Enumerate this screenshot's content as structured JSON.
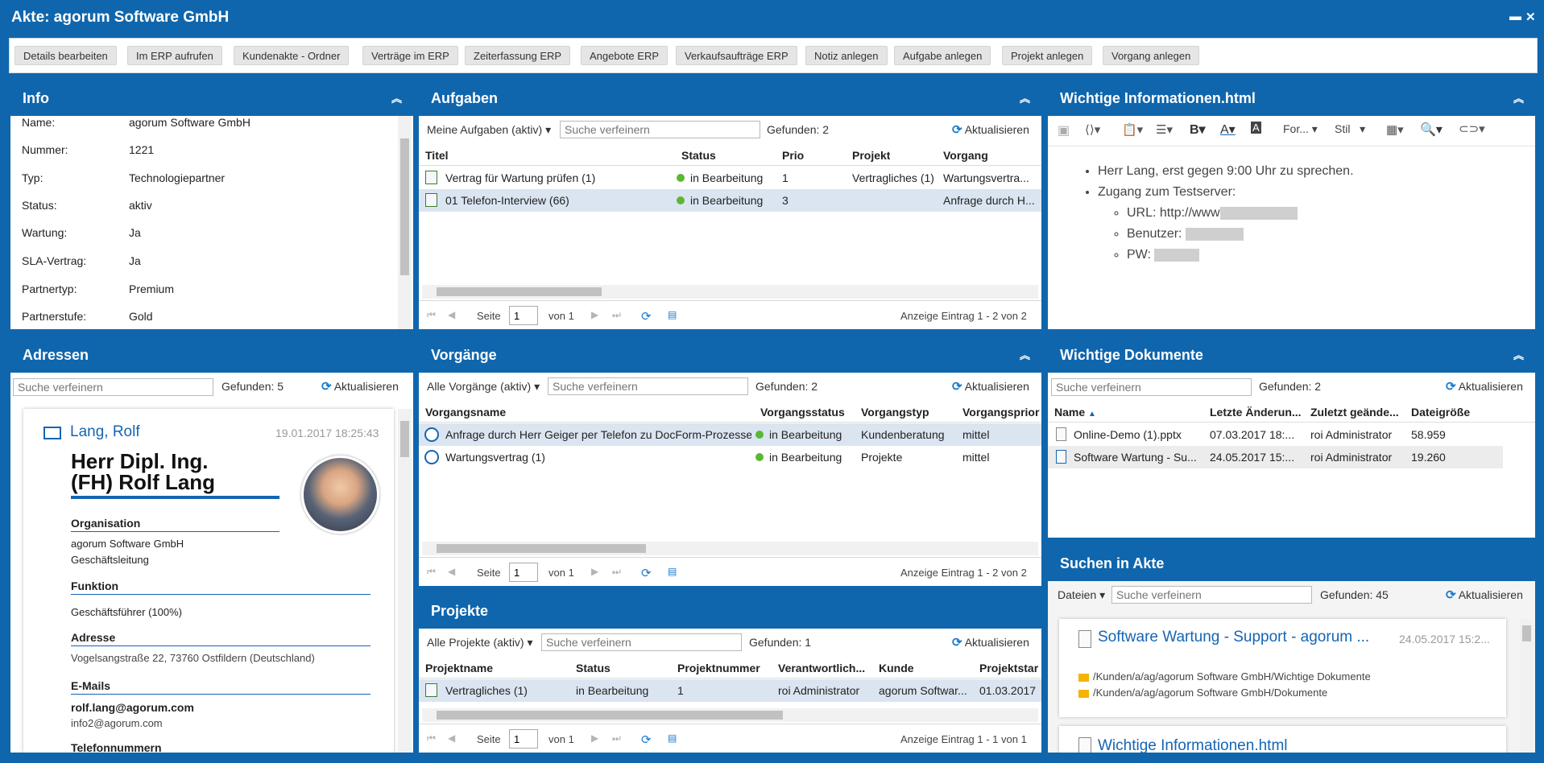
{
  "window": {
    "title": "Akte: agorum Software GmbH"
  },
  "toolbar": [
    "Details bearbeiten",
    "Im ERP aufrufen",
    "Kundenakte - Ordner",
    "Verträge im ERP",
    "Zeiterfassung ERP",
    "Angebote ERP",
    "Verkaufsaufträge ERP",
    "Notiz anlegen",
    "Aufgabe anlegen",
    "Projekt anlegen",
    "Vorgang anlegen"
  ],
  "info": {
    "title": "Info",
    "rows": [
      {
        "k": "Name:",
        "v": "agorum Software GmbH"
      },
      {
        "k": "Nummer:",
        "v": "1221"
      },
      {
        "k": "Typ:",
        "v": "Technologiepartner"
      },
      {
        "k": "Status:",
        "v": "aktiv"
      },
      {
        "k": "Wartung:",
        "v": "Ja"
      },
      {
        "k": "SLA-Vertrag:",
        "v": "Ja"
      },
      {
        "k": "Partnertyp:",
        "v": "Premium"
      },
      {
        "k": "Partnerstufe:",
        "v": "Gold"
      }
    ]
  },
  "aufgaben": {
    "title": "Aufgaben",
    "filter": "Meine Aufgaben (aktiv)",
    "search_placeholder": "Suche verfeinern",
    "found": "Gefunden: 2",
    "refresh": "Aktualisieren",
    "columns": [
      "Titel",
      "Status",
      "Prio",
      "Projekt",
      "Vorgang"
    ],
    "rows": [
      {
        "titel": "Vertrag für Wartung prüfen (1)",
        "status": "in Bearbeitung",
        "prio": "1",
        "projekt": "Vertragliches (1)",
        "vorgang": "Wartungsvertra..."
      },
      {
        "titel": "01 Telefon-Interview (66)",
        "status": "in Bearbeitung",
        "prio": "3",
        "projekt": "",
        "vorgang": "Anfrage durch H..."
      }
    ],
    "pager": {
      "seite": "Seite",
      "page": "1",
      "von": "von 1",
      "anzeige": "Anzeige Eintrag 1 - 2 von 2"
    }
  },
  "wichtig": {
    "title": "Wichtige Informationen.html",
    "toolbar": {
      "format": "For...",
      "stil": "Stil"
    },
    "items": [
      "Herr Lang, erst gegen 9:00 Uhr zu sprechen.",
      "Zugang zum Testserver:"
    ],
    "sub": [
      "URL: http://www",
      "Benutzer:",
      "PW:"
    ]
  },
  "adressen": {
    "title": "Adressen",
    "search_placeholder": "Suche verfeinern",
    "found": "Gefunden: 5",
    "refresh": "Aktualisieren",
    "card": {
      "name": "Lang, Rolf",
      "date": "19.01.2017 18:25:43",
      "fullname1": "Herr Dipl. Ing.",
      "fullname2": "(FH) Rolf Lang",
      "org_label": "Organisation",
      "org1": "agorum Software GmbH",
      "org2": "Geschäftsleitung",
      "funktion_label": "Funktion",
      "funktion": "Geschäftsführer (100%)",
      "adresse_label": "Adresse",
      "adresse": "Vogelsangstraße 22, 73760 Ostfildern (Deutschland)",
      "emails_label": "E-Mails",
      "email1": "rolf.lang@agorum.com",
      "email2": "info2@agorum.com",
      "tel_label": "Telefonnummern"
    }
  },
  "vorgaenge": {
    "title": "Vorgänge",
    "filter": "Alle Vorgänge (aktiv)",
    "search_placeholder": "Suche verfeinern",
    "found": "Gefunden: 2",
    "refresh": "Aktualisieren",
    "columns": [
      "Vorgangsname",
      "Vorgangsstatus",
      "Vorgangstyp",
      "Vorgangsprior"
    ],
    "rows": [
      {
        "name": "Anfrage durch Herr Geiger per Telefon zu DocForm-Prozesse...",
        "status": "in Bearbeitung",
        "typ": "Kundenberatung",
        "prio": "mittel"
      },
      {
        "name": "Wartungsvertrag (1)",
        "status": "in Bearbeitung",
        "typ": "Projekte",
        "prio": "mittel"
      }
    ],
    "pager": {
      "seite": "Seite",
      "page": "1",
      "von": "von 1",
      "anzeige": "Anzeige Eintrag 1 - 2 von 2"
    }
  },
  "projekte": {
    "title": "Projekte",
    "filter": "Alle Projekte (aktiv)",
    "search_placeholder": "Suche verfeinern",
    "found": "Gefunden: 1",
    "refresh": "Aktualisieren",
    "columns": [
      "Projektname",
      "Status",
      "Projektnummer",
      "Verantwortlich...",
      "Kunde",
      "Projektstar"
    ],
    "rows": [
      {
        "name": "Vertragliches (1)",
        "status": "in Bearbeitung",
        "nummer": "1",
        "verantw": "roi Administrator",
        "kunde": "agorum Softwar...",
        "start": "01.03.2017"
      }
    ],
    "pager": {
      "seite": "Seite",
      "page": "1",
      "von": "von 1",
      "anzeige": "Anzeige Eintrag 1 - 1 von 1"
    }
  },
  "dokumente": {
    "title": "Wichtige Dokumente",
    "search_placeholder": "Suche verfeinern",
    "found": "Gefunden: 2",
    "refresh": "Aktualisieren",
    "columns": [
      "Name",
      "Letzte Änderun...",
      "Zuletzt geände...",
      "Dateigröße"
    ],
    "rows": [
      {
        "name": "Online-Demo (1).pptx",
        "date": "07.03.2017 18:...",
        "user": "roi Administrator",
        "size": "58.959"
      },
      {
        "name": "Software Wartung - Su...",
        "date": "24.05.2017 15:...",
        "user": "roi Administrator",
        "size": "19.260"
      }
    ]
  },
  "suchen": {
    "title": "Suchen in Akte",
    "filter": "Dateien",
    "search_placeholder": "Suche verfeinern",
    "found": "Gefunden: 45",
    "refresh": "Aktualisieren",
    "result": {
      "title": "Software Wartung - Support - agorum ...",
      "date": "24.05.2017 15:2...",
      "path1": "/Kunden/a/ag/agorum Software GmbH/Wichtige Dokumente",
      "path2": "/Kunden/a/ag/agorum Software GmbH/Dokumente"
    },
    "result2": "Wichtige Informationen.html"
  }
}
